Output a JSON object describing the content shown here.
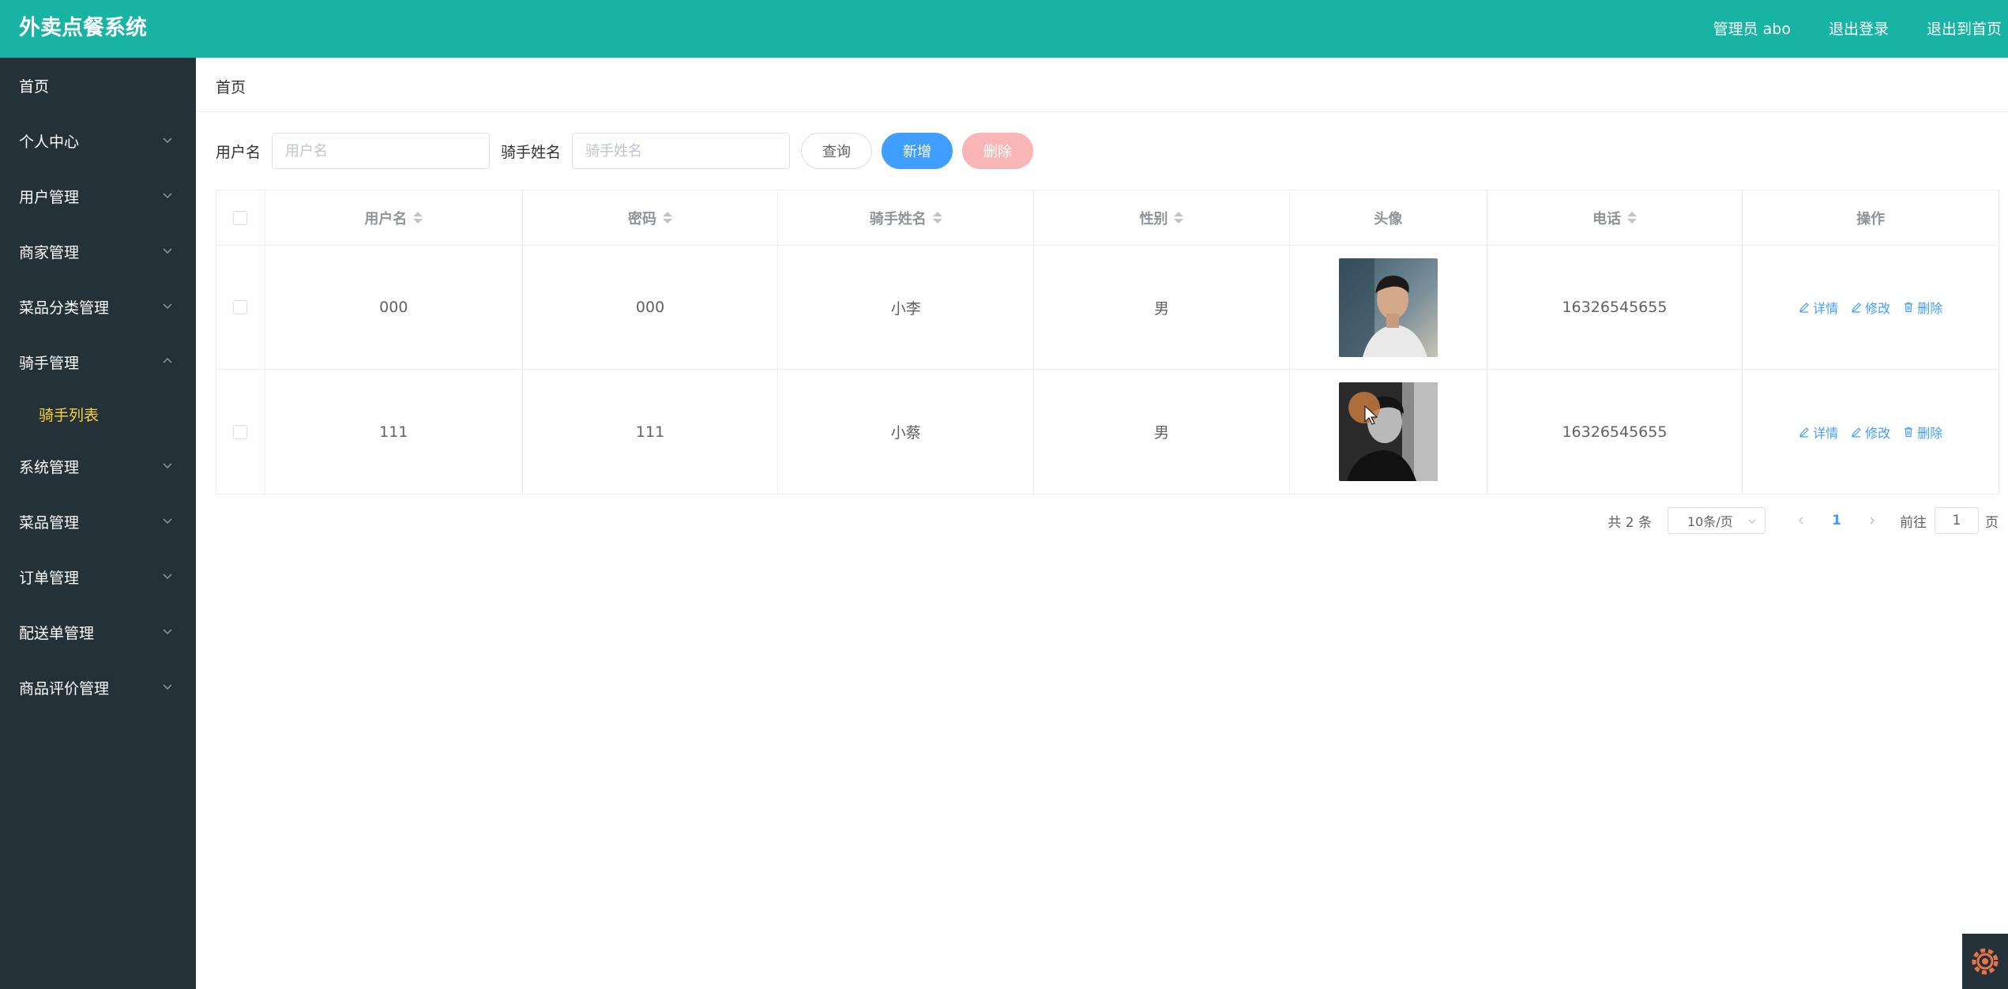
{
  "header": {
    "title": "外卖点餐系统",
    "user_label": "管理员 abo",
    "logout": "退出登录",
    "back_home": "退出到首页"
  },
  "sidebar": {
    "items": [
      {
        "label": "首页",
        "expandable": false
      },
      {
        "label": "个人中心",
        "expandable": true
      },
      {
        "label": "用户管理",
        "expandable": true
      },
      {
        "label": "商家管理",
        "expandable": true
      },
      {
        "label": "菜品分类管理",
        "expandable": true
      },
      {
        "label": "骑手管理",
        "expandable": true,
        "expanded": true,
        "sub": "骑手列表"
      },
      {
        "label": "系统管理",
        "expandable": true
      },
      {
        "label": "菜品管理",
        "expandable": true
      },
      {
        "label": "订单管理",
        "expandable": true
      },
      {
        "label": "配送单管理",
        "expandable": true
      },
      {
        "label": "商品评价管理",
        "expandable": true
      }
    ]
  },
  "breadcrumb": "首页",
  "search": {
    "username_label": "用户名",
    "username_placeholder": "用户名",
    "rider_label": "骑手姓名",
    "rider_placeholder": "骑手姓名",
    "query": "查询",
    "add": "新增",
    "delete": "删除"
  },
  "table": {
    "columns": [
      "用户名",
      "密码",
      "骑手姓名",
      "性别",
      "头像",
      "电话",
      "操作"
    ],
    "rows": [
      {
        "username": "000",
        "password": "000",
        "name": "小李",
        "gender": "男",
        "phone": "16326545655"
      },
      {
        "username": "111",
        "password": "111",
        "name": "小蔡",
        "gender": "男",
        "phone": "16326545655"
      }
    ],
    "actions": {
      "detail": "详情",
      "edit": "修改",
      "delete": "删除"
    }
  },
  "pagination": {
    "total": "共 2 条",
    "page_size": "10条/页",
    "current": "1",
    "goto_prefix": "前往",
    "goto_value": "1",
    "goto_suffix": "页"
  },
  "colors": {
    "header": "#17b3a3",
    "sidebar": "#243139",
    "active_sub": "#f7d33c",
    "primary": "#409eff",
    "danger_light": "#fab6b6"
  }
}
